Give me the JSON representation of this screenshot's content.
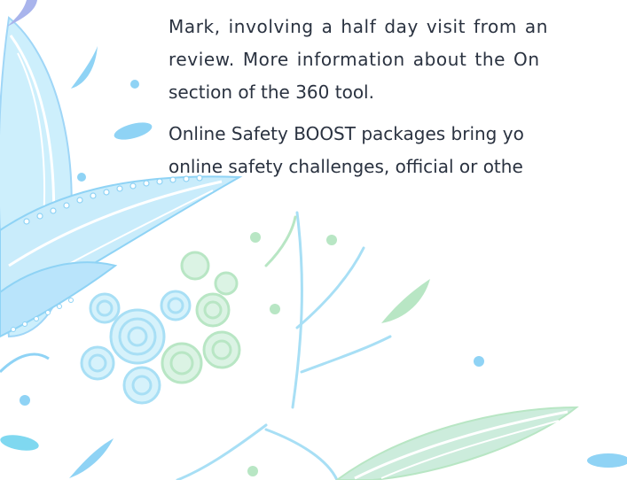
{
  "body_text": {
    "paragraph_1": {
      "line_1": "Mark, involving a half day visit from an",
      "line_2": "review. More information about the On",
      "line_3": "section of the 360 tool."
    },
    "paragraph_2": {
      "line_1": "Online Safety BOOST packages bring yo",
      "line_2": "online safety challenges, official or othe"
    }
  },
  "colors": {
    "text": "#2a3240",
    "decor_light_blue": "#8fd3f5",
    "decor_pale_blue": "#b9e4fb",
    "decor_lavender": "#a9b4ec",
    "decor_mint": "#b8e6c4",
    "decor_cyan": "#7fd8f0"
  }
}
